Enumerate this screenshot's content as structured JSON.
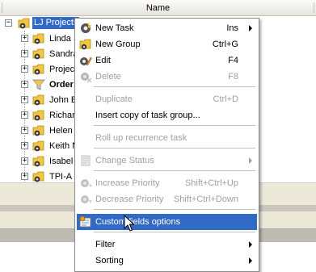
{
  "header": {
    "column_name": "Name"
  },
  "tree": {
    "root": {
      "label": "LJ Projects"
    },
    "children": [
      {
        "label": "Linda S",
        "bold": false,
        "icon": "folder-gear-icon"
      },
      {
        "label": "Sandra",
        "bold": false,
        "icon": "folder-gear-icon"
      },
      {
        "label": "Project",
        "bold": false,
        "icon": "folder-gear-icon"
      },
      {
        "label": "Order",
        "bold": true,
        "icon": "filter-icon"
      },
      {
        "label": "John B",
        "bold": false,
        "icon": "folder-gear-icon"
      },
      {
        "label": "Richard",
        "bold": false,
        "icon": "folder-gear-icon"
      },
      {
        "label": "Helen I",
        "bold": false,
        "icon": "folder-gear-icon"
      },
      {
        "label": "Keith N",
        "bold": false,
        "icon": "folder-gear-icon"
      },
      {
        "label": "Isabel",
        "bold": false,
        "icon": "folder-gear-icon"
      },
      {
        "label": "TPI-A I",
        "bold": false,
        "icon": "folder-gear-icon"
      }
    ]
  },
  "menu": {
    "items": [
      {
        "id": "new-task",
        "label": "New Task",
        "shortcut": "Ins",
        "submenu": true,
        "disabled": false,
        "icon": "new-task-icon"
      },
      {
        "id": "new-group",
        "label": "New Group",
        "shortcut": "Ctrl+G",
        "submenu": false,
        "disabled": false,
        "icon": "new-group-icon"
      },
      {
        "id": "edit",
        "label": "Edit",
        "shortcut": "F4",
        "submenu": false,
        "disabled": false,
        "icon": "edit-icon"
      },
      {
        "id": "delete",
        "label": "Delete",
        "shortcut": "F8",
        "submenu": false,
        "disabled": true,
        "icon": "delete-icon"
      },
      {
        "id": "duplicate",
        "label": "Duplicate",
        "shortcut": "Ctrl+D",
        "submenu": false,
        "disabled": true,
        "icon": ""
      },
      {
        "id": "insert-copy",
        "label": "Insert copy of task group...",
        "shortcut": "",
        "submenu": false,
        "disabled": false,
        "icon": ""
      },
      {
        "id": "roll-up",
        "label": "Roll up recurrence task",
        "shortcut": "",
        "submenu": false,
        "disabled": true,
        "icon": ""
      },
      {
        "id": "change-status",
        "label": "Change Status",
        "shortcut": "",
        "submenu": true,
        "disabled": true,
        "icon": "change-status-icon"
      },
      {
        "id": "increase-priority",
        "label": "Increase Priority",
        "shortcut": "Shift+Ctrl+Up",
        "submenu": false,
        "disabled": true,
        "icon": "increase-priority-icon"
      },
      {
        "id": "decrease-priority",
        "label": "Decrease Priority",
        "shortcut": "Shift+Ctrl+Down",
        "submenu": false,
        "disabled": true,
        "icon": "decrease-priority-icon"
      },
      {
        "id": "custom-fields",
        "label": "Custom fields options",
        "shortcut": "",
        "submenu": false,
        "disabled": false,
        "highlighted": true,
        "icon": "custom-fields-icon"
      },
      {
        "id": "filter",
        "label": "Filter",
        "shortcut": "",
        "submenu": true,
        "disabled": false,
        "icon": ""
      },
      {
        "id": "sorting",
        "label": "Sorting",
        "shortcut": "",
        "submenu": true,
        "disabled": false,
        "icon": ""
      }
    ]
  },
  "colors": {
    "selection": "#316ac5",
    "disabled_text": "#a0a0a0",
    "menu_bg": "#ffffff",
    "toolbar_bg": "#ece9d8"
  }
}
